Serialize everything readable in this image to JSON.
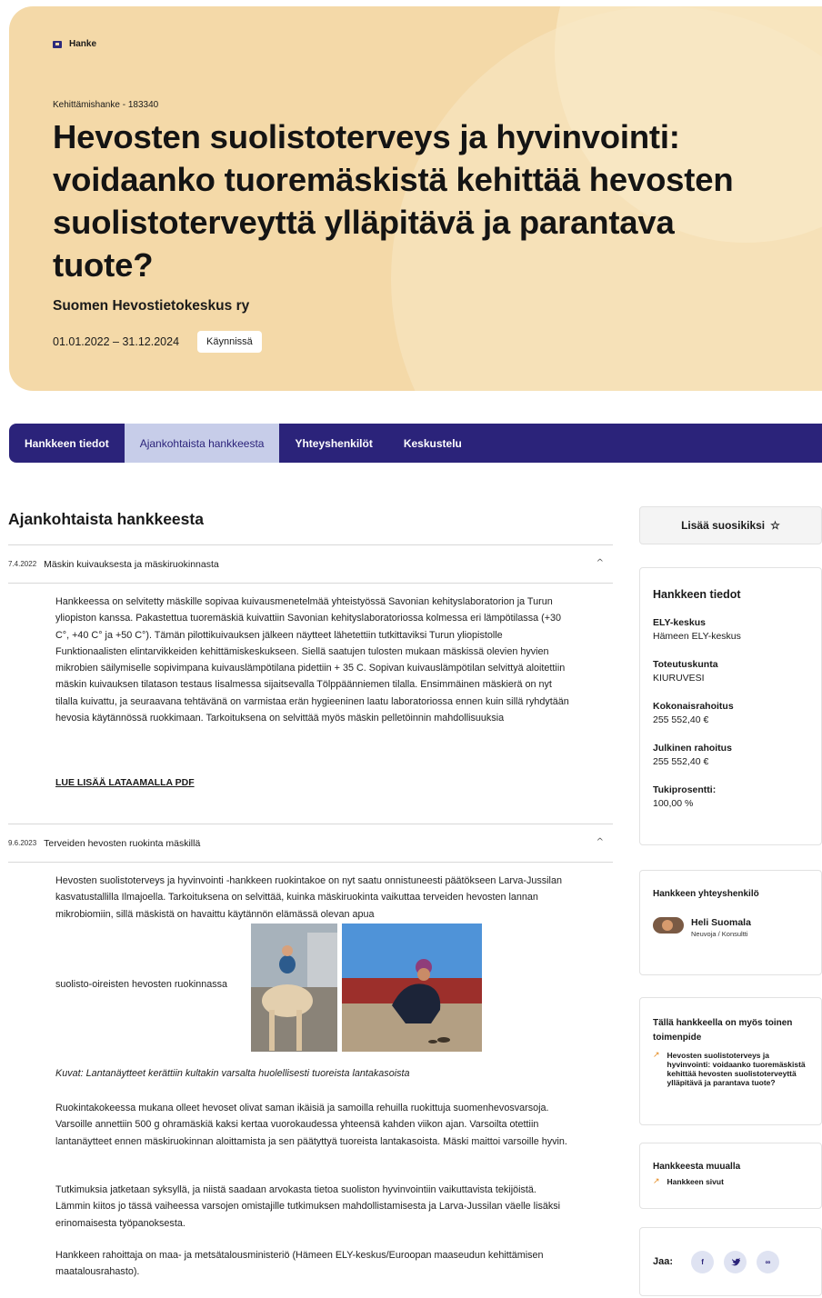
{
  "hero": {
    "crumb": "Hanke",
    "subhead": "Kehittämishanke - 183340",
    "title": "Hevosten suolistoterveys ja hyvinvointi: voidaanko tuoremäskistä kehittää hevosten suolistoterveyttä ylläpitävä ja parantava tuote?",
    "org": "Suomen Hevostietokeskus ry",
    "dates": "01.01.2022 – 31.12.2024",
    "status": "Käynnissä"
  },
  "tabs": [
    {
      "label": "Hankkeen tiedot"
    },
    {
      "label": "Ajankohtaista hankkeesta"
    },
    {
      "label": "Yhteyshenkilöt"
    },
    {
      "label": "Keskustelu"
    }
  ],
  "main": {
    "section_title": "Ajankohtaista hankkeesta",
    "item1": {
      "date": "7.4.2022",
      "title": "Mäskin kuivauksesta ja mäskiruokinnasta",
      "body": "Hankkeessa on selvitetty mäskille sopivaa kuivausmenetelmää yhteistyössä Savonian kehityslaboratorion ja Turun yliopiston kanssa. Pakastettua tuoremäskiä kuivattiin Savonian kehityslaboratoriossa kolmessa eri lämpötilassa (+30 C°, +40 C° ja +50 C°). Tämän pilottikuivauksen jälkeen näytteet lähetettiin tutkittaviksi Turun yliopistolle Funktionaalisten elintarvikkeiden kehittämiskeskukseen. Siellä saatujen tulosten mukaan mäskissä olevien hyvien mikrobien säilymiselle sopivimpana kuivauslämpötilana pidettiin + 35 C. Sopivan kuivauslämpötilan selvittyä aloitettiin mäskin kuivauksen tilatason testaus Iisalmessa sijaitsevalla Tölppäänniemen tilalla. Ensimmäinen mäskierä on nyt tilalla kuivattu, ja seuraavana tehtävänä on varmistaa erän hygieeninen laatu laboratoriossa ennen kuin sillä ryhdytään hevosia käytännössä ruokkimaan. Tarkoituksena on selvittää myös mäskin pelletöinnin mahdollisuuksia",
      "link": "LUE LISÄÄ LATAAMALLA PDF"
    },
    "item2": {
      "date": "9.6.2023",
      "title": "Terveiden hevosten ruokinta mäskillä",
      "p1": "Hevosten suolistoterveys ja hyvinvointi -hankkeen ruokintakoe on nyt saatu onnistuneesti päätökseen Larva-Jussilan kasvatustallilla Ilmajoella. Tarkoituksena on selvittää, kuinka mäskiruokinta vaikuttaa terveiden hevosten lannan mikrobiomiin, sillä mäskistä on havaittu käytännön elämässä olevan apua",
      "p1_end": "suolisto-oireisten hevosten ruokinnassa",
      "caption": "Kuvat: Lantanäytteet kerättiin kultakin varsalta huolellisesti tuoreista lantakasoista",
      "p2": "Ruokintakokeessa mukana olleet hevoset olivat saman ikäisiä ja samoilla rehuilla ruokittuja suomenhevosvarsoja. Varsoille annettiin 500 g ohramäskiä kaksi kertaa vuorokaudessa yhteensä kahden viikon ajan. Varsoilta otettiin lantanäytteet ennen mäskiruokinnan aloittamista ja sen päätyttyä tuoreista lantakasoista. Mäski maittoi varsoille hyvin.",
      "p3": "Tutkimuksia jatketaan syksyllä, ja niistä saadaan arvokasta tietoa suoliston hyvinvointiin vaikuttavista tekijöistä. Lämmin kiitos jo tässä vaiheessa varsojen omistajille tutkimuksen mahdollistamisesta ja Larva-Jussilan väelle lisäksi erinomaisesta työpanoksesta.",
      "p4": "Hankkeen rahoittaja on maa- ja metsätalousministeriö (Hämeen ELY-keskus/Euroopan maaseudun kehittämisen maatalousrahasto)."
    }
  },
  "sidebar": {
    "fav_label": "Lisää suosikiksi",
    "fav_icon": "star-outline-icon",
    "info_title": "Hankkeen tiedot",
    "info": [
      {
        "label": "ELY-keskus",
        "value": "Hämeen ELY-keskus"
      },
      {
        "label": "Toteutuskunta",
        "value": "KIURUVESI"
      },
      {
        "label": "Kokonaisrahoitus",
        "value": "255 552,40 €"
      },
      {
        "label": "Julkinen rahoitus",
        "value": "255 552,40 €"
      },
      {
        "label": "Tukiprosentti:",
        "value": "100,00 %"
      }
    ],
    "contact_title": "Hankkeen yhteyshenkilö",
    "contact_name": "Heli Suomala",
    "contact_role": "Neuvoja / Konsultti",
    "other_title": "Tällä hankkeella on myös toinen toimenpide",
    "other_item": "Hevosten suolistoterveys ja hyvinvointi: voidaanko tuoremäskistä kehittää hevosten suolistoterveyttä ylläpitävä ja parantava tuote?",
    "else_title": "Hankkeesta muualla",
    "else_item": "Hankkeen sivut",
    "share_label": "Jaa:",
    "share": [
      {
        "label": "f",
        "icon": "facebook-icon"
      },
      {
        "label": "t",
        "icon": "twitter-icon"
      },
      {
        "label": "∞",
        "icon": "link-icon"
      }
    ]
  },
  "colors": {
    "hero_bg": "#f4d9a8",
    "tabs_bg": "#2b237a",
    "tab_active_bg": "#c7cde9",
    "accent_arrow": "#e58a1f"
  }
}
